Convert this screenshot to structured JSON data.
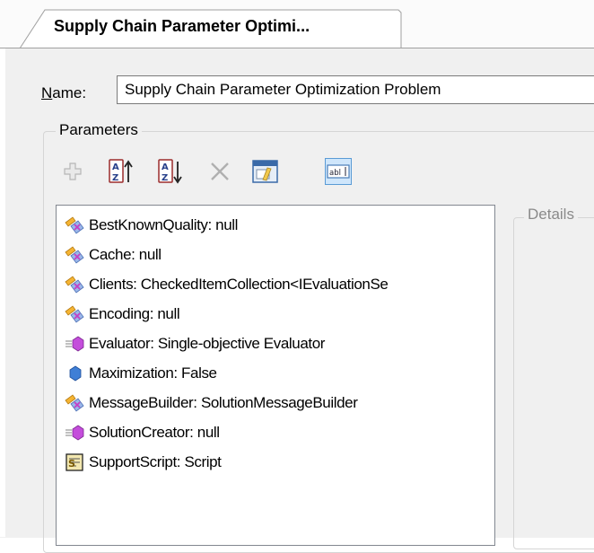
{
  "tab": {
    "title": "Supply Chain Parameter Optimi..."
  },
  "name": {
    "label_underlined": "N",
    "label_rest": "ame:",
    "value": "Supply Chain Parameter Optimization Problem"
  },
  "parameters": {
    "group_title": "Parameters",
    "toolbar": [
      {
        "name": "add-button",
        "icon": "plus-icon",
        "enabled": false
      },
      {
        "name": "sort-ascending-button",
        "icon": "sort-az-ascending-icon",
        "enabled": true
      },
      {
        "name": "sort-descending-button",
        "icon": "sort-az-descending-icon",
        "enabled": true
      },
      {
        "name": "remove-button",
        "icon": "x-icon",
        "enabled": false
      },
      {
        "name": "show-hidden-button",
        "icon": "properties-icon",
        "enabled": true
      },
      {
        "name": "rename-button",
        "icon": "text-field-icon",
        "enabled": true,
        "pressed": true
      }
    ],
    "items": [
      {
        "label": "BestKnownQuality: null",
        "icon": "lookup-parameter-icon"
      },
      {
        "label": "Cache: null",
        "icon": "lookup-parameter-icon"
      },
      {
        "label": "Clients: CheckedItemCollection<IEvaluationSe",
        "icon": "lookup-parameter-icon"
      },
      {
        "label": "Encoding: null",
        "icon": "lookup-parameter-icon"
      },
      {
        "label": "Evaluator: Single-objective Evaluator",
        "icon": "value-parameter-icon"
      },
      {
        "label": "Maximization: False",
        "icon": "fixed-value-icon"
      },
      {
        "label": "MessageBuilder: SolutionMessageBuilder",
        "icon": "lookup-parameter-icon"
      },
      {
        "label": "SolutionCreator: null",
        "icon": "value-parameter-icon"
      },
      {
        "label": "SupportScript: Script",
        "icon": "script-icon"
      }
    ]
  },
  "details": {
    "title": "Details"
  },
  "colors": {
    "selected_button_bg": "#cfe6fb",
    "selected_button_border": "#5a9bd5",
    "panel_bg": "#f0f0f0"
  }
}
